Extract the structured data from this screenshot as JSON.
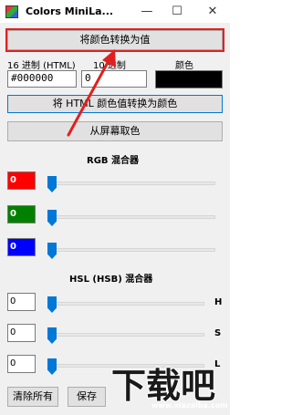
{
  "window": {
    "title": "Colors MiniLa...",
    "controls": {
      "minimize": "—",
      "maximize": "☐",
      "close": "✕"
    }
  },
  "top_button": {
    "label": "将颜色转换为值"
  },
  "hex": {
    "label": "16 进制 (HTML)",
    "value": "#000000"
  },
  "dec": {
    "label": "10 进制",
    "value": "0"
  },
  "preview": {
    "label": "颜色",
    "color": "#000000"
  },
  "convert_html_button": {
    "label": "将 HTML 颜色值转换为颜色"
  },
  "pick_screen_button": {
    "label": "从屏幕取色"
  },
  "rgb": {
    "title": "RGB 混合器",
    "channels": [
      {
        "name": "red",
        "value": "0",
        "color": "#ff0000"
      },
      {
        "name": "green",
        "value": "0",
        "color": "#008000"
      },
      {
        "name": "blue",
        "value": "0",
        "color": "#0000ff"
      }
    ]
  },
  "hsl": {
    "title": "HSL (HSB) 混合器",
    "channels": [
      {
        "name": "hue",
        "letter": "H",
        "value": "0"
      },
      {
        "name": "saturation",
        "letter": "S",
        "value": "0"
      },
      {
        "name": "lightness",
        "letter": "L",
        "value": "0"
      }
    ]
  },
  "footer": {
    "clear_all": "清除所有",
    "save": "保存"
  },
  "watermark": {
    "logo_text": "下载吧",
    "url": "www.xiazaiba.com"
  },
  "colors": {
    "accent": "#0078d7",
    "annotation": "#e02020",
    "window_bg": "#f0f0f0"
  }
}
